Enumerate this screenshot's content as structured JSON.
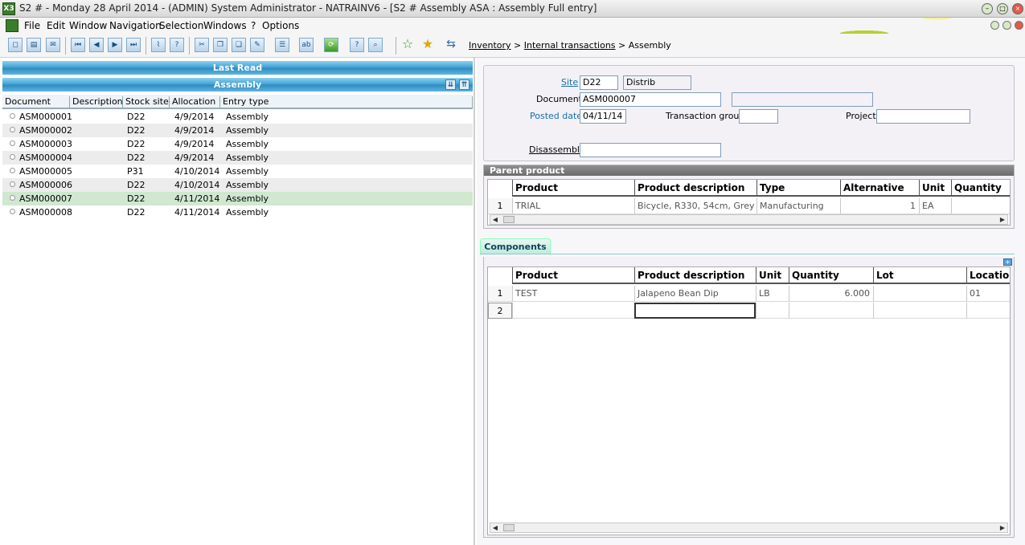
{
  "window": {
    "title": "S2 # - Monday 28 April 2014 - (ADMIN) System Administrator - NATRAINV6 - [S2 # Assembly ASA : Assembly Full entry]"
  },
  "menu": {
    "items": [
      "File",
      "Edit",
      "Window",
      "Navigation",
      "Selection",
      "Windows",
      "?",
      "Options"
    ]
  },
  "breadcrumb": {
    "level1": "Inventory",
    "sep1": ">",
    "level2": "Internal transactions",
    "sep2": ">",
    "current": "Assembly"
  },
  "left_panel": {
    "last_read_label": "Last Read",
    "assembly_label": "Assembly",
    "columns": [
      "Document",
      "Description",
      "Stock site",
      "Allocation",
      "Entry type"
    ],
    "rows": [
      {
        "document": "ASM000001",
        "description": "",
        "site": "D22",
        "allocation": "4/9/2014",
        "entry_type": "Assembly"
      },
      {
        "document": "ASM000002",
        "description": "",
        "site": "D22",
        "allocation": "4/9/2014",
        "entry_type": "Assembly"
      },
      {
        "document": "ASM000003",
        "description": "",
        "site": "D22",
        "allocation": "4/9/2014",
        "entry_type": "Assembly"
      },
      {
        "document": "ASM000004",
        "description": "",
        "site": "D22",
        "allocation": "4/9/2014",
        "entry_type": "Assembly"
      },
      {
        "document": "ASM000005",
        "description": "",
        "site": "P31",
        "allocation": "4/10/2014",
        "entry_type": "Assembly"
      },
      {
        "document": "ASM000006",
        "description": "",
        "site": "D22",
        "allocation": "4/10/2014",
        "entry_type": "Assembly"
      },
      {
        "document": "ASM000007",
        "description": "",
        "site": "D22",
        "allocation": "4/11/2014",
        "entry_type": "Assembly"
      },
      {
        "document": "ASM000008",
        "description": "",
        "site": "D22",
        "allocation": "4/11/2014",
        "entry_type": "Assembly"
      }
    ],
    "selected_document": "ASM000007"
  },
  "form": {
    "site_label": "Site",
    "site_value": "D22",
    "site_desc": "Distrib",
    "document_label": "Document",
    "document_value": "ASM000007",
    "document_extra": "",
    "posted_date_label": "Posted date",
    "posted_date_value": "04/11/14",
    "transaction_group_label": "Transaction group",
    "transaction_group_value": "",
    "project_label": "Project",
    "project_value": "",
    "disassembly_label": "Disassembly",
    "disassembly_value": ""
  },
  "parent_product": {
    "section_title": "Parent product",
    "columns": [
      "Product",
      "Product description",
      "Type",
      "Alternative",
      "Unit",
      "Quantity"
    ],
    "rows": [
      {
        "n": "1",
        "product": "TRIAL",
        "description": "Bicycle, R330, 54cm, Grey",
        "type": "Manufacturing",
        "alternative": "1",
        "unit": "EA",
        "quantity": ""
      }
    ]
  },
  "components": {
    "tab_label": "Components",
    "columns": [
      "Product",
      "Product description",
      "Unit",
      "Quantity",
      "Lot",
      "Location"
    ],
    "rows": [
      {
        "n": "1",
        "product": "TEST",
        "description": "Jalapeno Bean Dip",
        "unit": "LB",
        "quantity": "6.000",
        "lot": "",
        "location": "01"
      },
      {
        "n": "2",
        "product": "",
        "description": "",
        "unit": "",
        "quantity": "",
        "lot": "",
        "location": ""
      }
    ]
  },
  "colors": {
    "accent_blue": "#3c9ed3",
    "selected_row": "#cfe8cf",
    "link": "#1a6ea8"
  },
  "icons": [
    "first-record-icon",
    "previous-record-icon",
    "next-record-icon",
    "last-record-icon",
    "help-icon",
    "favorite-add-icon",
    "favorite-star-icon",
    "signpost-icon"
  ]
}
